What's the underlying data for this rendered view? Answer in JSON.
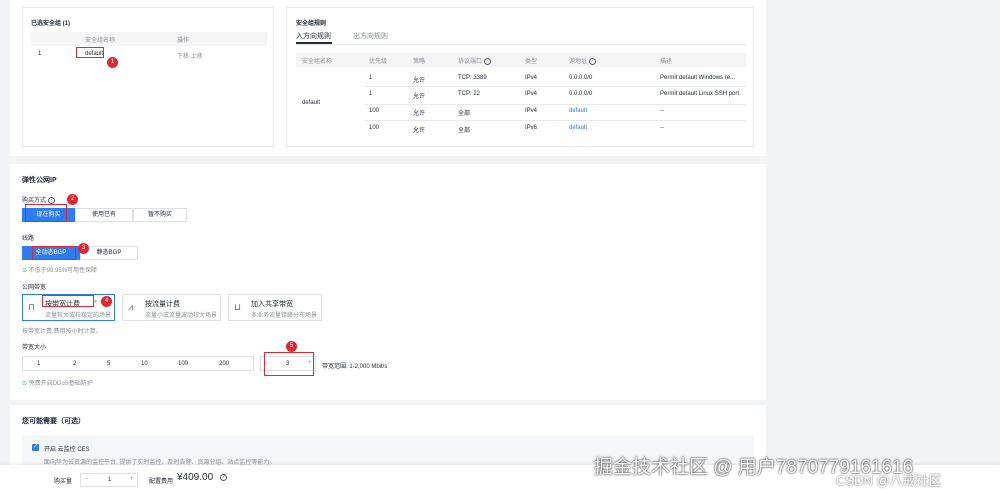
{
  "sg_left": {
    "title": "已选安全组 (1)",
    "col_name": "安全组名称",
    "col_ops": "操作",
    "row": {
      "index": "1",
      "name": "default",
      "ops": "下移  上移"
    },
    "badge": "1"
  },
  "sg_rules": {
    "title": "安全组规则",
    "tab_in": "入方向规则",
    "tab_out": "出方向规则",
    "cols": [
      "安全组名称",
      "优先级",
      "策略",
      "协议端口",
      "类型",
      "源地址",
      "描述"
    ],
    "group": "default",
    "rows": [
      [
        "1",
        "允许",
        "TCP: 3389",
        "IPv4",
        "0.0.0.0/0",
        "Permit default Windows re..."
      ],
      [
        "1",
        "允许",
        "TCP: 22",
        "IPv4",
        "0.0.0.0/0",
        "Permit default Linux SSH port"
      ],
      [
        "100",
        "允许",
        "全部",
        "IPv4",
        "default",
        "--"
      ],
      [
        "100",
        "允许",
        "全部",
        "IPv6",
        "default",
        "--"
      ]
    ]
  },
  "eip": {
    "title": "弹性公网IP",
    "buy_label": "购买方式",
    "buy_opts": [
      "现在购买",
      "使用已有",
      "暂不购买"
    ],
    "line_label": "线路",
    "line_opts": [
      "全动态BGP",
      "静态BGP"
    ],
    "line_note": "不低于99.95%可用性保障",
    "bw_type_label": "公网带宽",
    "bw_types": [
      {
        "title": "按带宽计费",
        "sub": "流量较大或较稳定的场景"
      },
      {
        "title": "按流量计费",
        "sub": "流量小或流量波动较大场景"
      },
      {
        "title": "加入共享带宽",
        "sub": "多业务流量错峰分布场景"
      }
    ],
    "bw_type_note": "按带宽计费,费用按小时计算。",
    "bw_size_label": "带宽大小",
    "bw_sizes": [
      "1",
      "2",
      "5",
      "10",
      "100",
      "200"
    ],
    "bw_value": "3",
    "bw_minus": "−",
    "bw_plus": "+",
    "bw_range": "带宽范围: 1-2,000 Mbit/s",
    "ddos_note": "免费开启DDoS基础防护",
    "badges": [
      "2",
      "3",
      "4",
      "5"
    ]
  },
  "extra": {
    "title": "您可能需要（可选）",
    "ces_label": "开启 云监控 CES",
    "ces_desc": "面向华为云资源的监控平台, 提供了实时监控、及时告警、资源分组、站点监控等能力。"
  },
  "footer": {
    "qty_label": "购买量",
    "qty_minus": "−",
    "qty_value": "1",
    "qty_plus": "+",
    "price_label": "配置费用",
    "price": "¥409.00",
    "watermark": "掘金技术社区 @ 用户7870779161616",
    "csdn": "CSDN @八戒社区"
  },
  "colors": {
    "accent": "#2e7df0",
    "marker": "#e0282e"
  }
}
